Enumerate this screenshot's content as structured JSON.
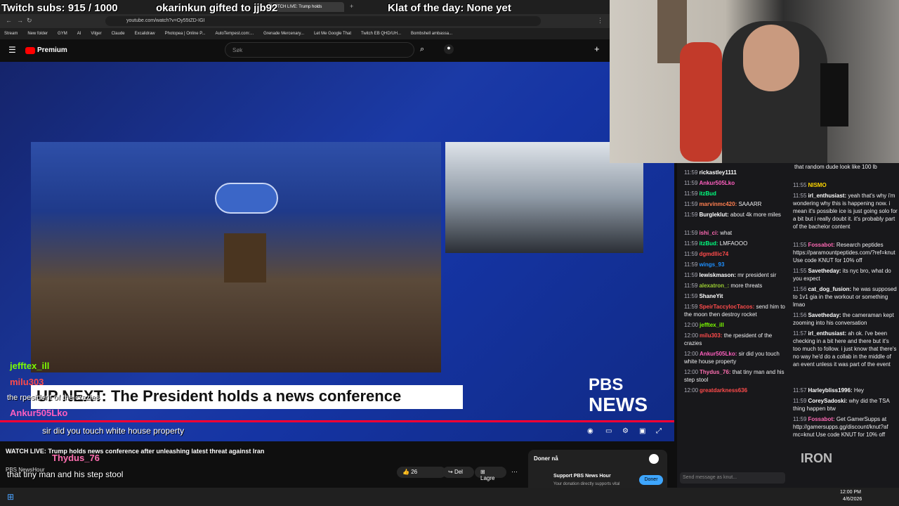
{
  "overlay": {
    "subs_label": "Twitch subs: 915 / 1000",
    "gift_label": "okarinkun gifted to jjb92",
    "klat_label": "Klat of the day: None yet"
  },
  "browser": {
    "url": "youtube.com/watch?v=Oy55tZD-IGI",
    "tab_title": "WATCH LIVE: Trump holds",
    "bookmarks": [
      "Stream",
      "New folder",
      "GYM",
      "AI",
      "Vilger",
      "Claude",
      "Excalidraw",
      "Photopea | Online P...",
      "AutoTempest.com:...",
      "Grenade Mercenary...",
      "Let Me Google That",
      "Twitch EB QHD/UH...",
      "Bombshell ambassa..."
    ]
  },
  "youtube": {
    "logo": "Premium",
    "search_placeholder": "Søk",
    "banner_text": "UP NEXT: The President holds a news conference",
    "pbs_line1": "PBS",
    "pbs_line2": "NEWS",
    "video_title": "WATCH LIVE: Trump holds news conference after unleashing latest threat against Iran",
    "channel": "PBS NewsHour",
    "like_count": "26",
    "share_label": "Del",
    "save_label": "Lagre",
    "donate_header": "Doner nå",
    "donate_title": "Support PBS News Hour",
    "donate_sub": "Your donation directly supports vital",
    "donate_button": "Doner"
  },
  "stream_overlay_chat": [
    {
      "user": "jefftex_ill",
      "msg": "",
      "color": "#7cfc00"
    },
    {
      "user": "milu303",
      "msg": "the rpesident of the crazies",
      "color": "#ff4b4b"
    },
    {
      "user": "Ankur505Lko",
      "msg": "sir did you touch white house property",
      "color": "#ff5fbf"
    },
    {
      "user": "Thydus_76",
      "msg": "that tiny man and his step stool",
      "color": "#ff6fb1"
    },
    {
      "user": "greatdarkness636",
      "msg": "",
      "color": "#ff4b4b"
    }
  ],
  "chat_left": [
    {
      "ts": "11:59",
      "user": "rickastley1111",
      "msg": "",
      "color": "#ffffff"
    },
    {
      "ts": "11:59",
      "user": "Ankur505Lko",
      "msg": "",
      "color": "#ff5fbf"
    },
    {
      "ts": "11:59",
      "user": "itzBud",
      "msg": "",
      "color": "#00ff7f"
    },
    {
      "ts": "11:59",
      "user": "marvinmc420",
      "msg": "SAAARR",
      "color": "#ff7f50"
    },
    {
      "ts": "11:59",
      "user": "Burgleklut",
      "msg": "about 4k more miles",
      "color": "#ffffff"
    },
    {
      "ts": "11:59",
      "user": "ishi_ci",
      "msg": "what",
      "color": "#ff69b4"
    },
    {
      "ts": "11:59",
      "user": "itzBud",
      "msg": "LMFAOOO",
      "color": "#00ff7f"
    },
    {
      "ts": "11:59",
      "user": "dgmdllic74",
      "msg": "",
      "color": "#ff4b4b"
    },
    {
      "ts": "11:59",
      "user": "wings_93",
      "msg": "",
      "color": "#1e90ff"
    },
    {
      "ts": "11:59",
      "user": "lewiskmason",
      "msg": "mr president sir",
      "color": "#ffffff"
    },
    {
      "ts": "11:59",
      "user": "alexatron_",
      "msg": "more threats",
      "color": "#9acd32"
    },
    {
      "ts": "11:59",
      "user": "ShaneYit",
      "msg": "",
      "color": "#ffffff"
    },
    {
      "ts": "11:59",
      "user": "SpeirTaccylocTacos",
      "msg": "send him to the moon then destroy rocket",
      "color": "#ff4b4b"
    },
    {
      "ts": "12:00",
      "user": "jefftex_ill",
      "msg": "",
      "color": "#7cfc00"
    },
    {
      "ts": "12:00",
      "user": "milu303",
      "msg": "the rpesident of the crazies",
      "color": "#ff4b4b"
    },
    {
      "ts": "12:00",
      "user": "Ankur505Lko",
      "msg": "sir did you touch white house property",
      "color": "#ff5fbf"
    },
    {
      "ts": "12:00",
      "user": "Thydus_76",
      "msg": "that tiny man and his step stool",
      "color": "#ff6fb1"
    },
    {
      "ts": "12:00",
      "user": "greatdarkness636",
      "msg": "",
      "color": "#ff4b4b"
    }
  ],
  "chat_right": [
    {
      "ts": "",
      "user": "",
      "msg": "that random dude look like 100 lb",
      "color": "#ffffff"
    },
    {
      "ts": "11:55",
      "user": "NISMO",
      "msg": "",
      "color": "#ffd700"
    },
    {
      "ts": "11:55",
      "user": "irl_enthusiast",
      "msg": "yeah that's why i'm wondering why this is happening now. i mean it's possible ice is just going solo for a bit but i really doubt it. it's probably part of the bachelor content",
      "color": "#ffffff"
    },
    {
      "ts": "11:55",
      "user": "Fossabot",
      "msg": "Research peptides https://paramountpeptides.com/?ref=knut Use code KNUT for 10% off",
      "color": "#ff69b4"
    },
    {
      "ts": "11:55",
      "user": "Savetheday",
      "msg": "its nyc bro, what do you expect",
      "color": "#ffffff"
    },
    {
      "ts": "11:56",
      "user": "cat_dog_fusion",
      "msg": "he was supposed to 1v1 gia in the workout or something lmao",
      "color": "#ffffff"
    },
    {
      "ts": "11:56",
      "user": "Savetheday",
      "msg": "the cameraman kept zooming into his conversation",
      "color": "#ffffff"
    },
    {
      "ts": "11:57",
      "user": "irl_enthusiast",
      "msg": "ah ok. i've been checking in a bit here and there but it's too much to follow. i just know that there's no way he'd do a collab in the middle of an event unless it was part of the event",
      "color": "#ffffff"
    },
    {
      "ts": "11:57",
      "user": "Harleybliss1996",
      "msg": "Hey",
      "color": "#ffffff"
    },
    {
      "ts": "11:59",
      "user": "CoreySadoski",
      "msg": "why did the TSA thing happen btw",
      "color": "#ffffff"
    },
    {
      "ts": "11:59",
      "user": "Fossabot",
      "msg": "Get GamerSupps at http://gamersupps.gg/discount/knut?af mc=knut Use code KNUT for 10% off",
      "color": "#ff69b4"
    }
  ],
  "chat_input_placeholder": "Send message as knut...",
  "clock": {
    "time": "12:00 PM",
    "date": "4/6/2026"
  },
  "sponsor": "IRON"
}
